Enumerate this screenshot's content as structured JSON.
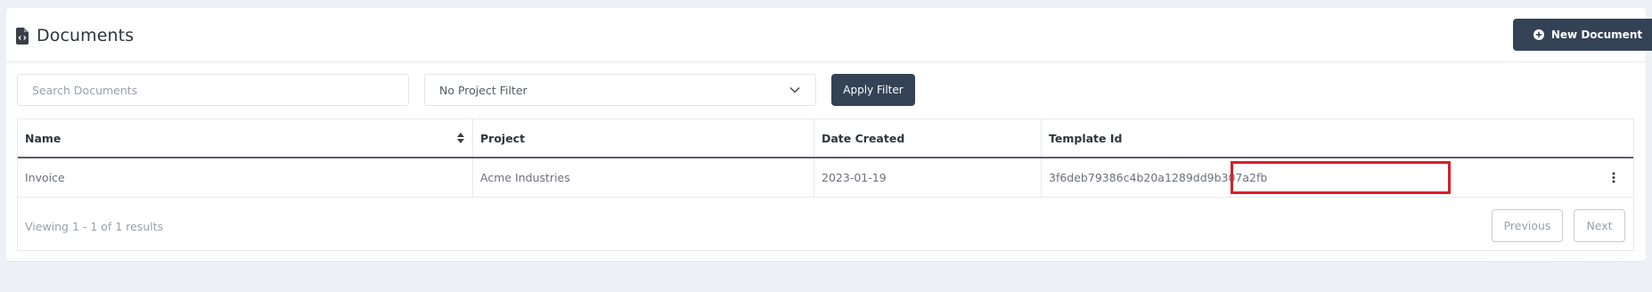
{
  "header": {
    "title": "Documents",
    "new_document_label": "New Document"
  },
  "filters": {
    "search_placeholder": "Search Documents",
    "search_value": "",
    "project_filter_selected": "No Project Filter",
    "apply_label": "Apply Filter"
  },
  "table": {
    "columns": [
      "Name",
      "Project",
      "Date Created",
      "Template Id"
    ],
    "rows": [
      {
        "name": "Invoice",
        "project": "Acme Industries",
        "date_created": "2023-01-19",
        "template_id": "3f6deb79386c4b20a1289dd9b307a2fb"
      }
    ]
  },
  "pagination": {
    "summary": "Viewing 1 - 1 of 1 results",
    "previous_label": "Previous",
    "next_label": "Next"
  },
  "icons": {
    "title": "file-code-icon",
    "new_document": "plus-circle-icon",
    "select": "chevron-down-icon",
    "sort": "sort-icon",
    "row_actions": "kebab-menu-icon"
  },
  "colors": {
    "primary_button": "#344256",
    "highlight_border": "#d4202a",
    "page_background": "#eef0f6"
  }
}
